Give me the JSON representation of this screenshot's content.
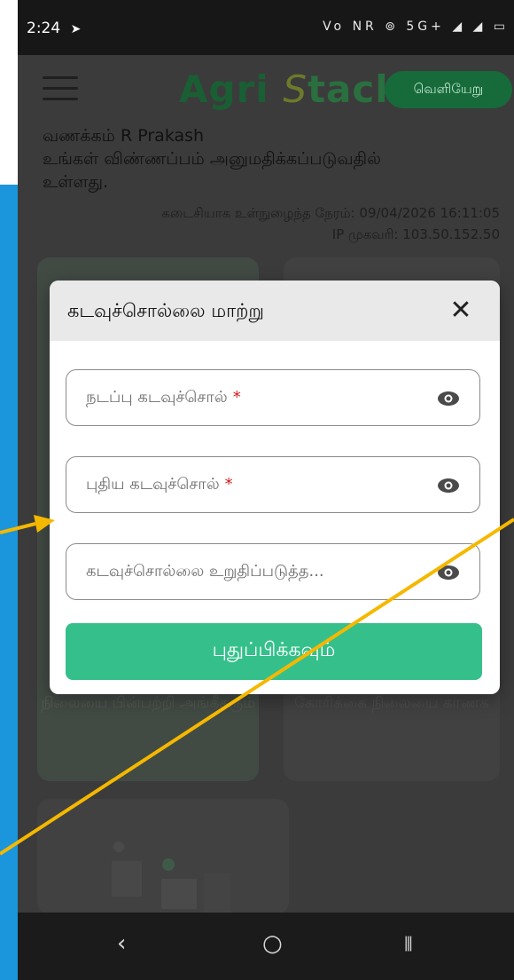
{
  "status_bar": {
    "time": "2:24",
    "nav_icon": "navigation-arrow-icon",
    "icons": "Vo NR ⊚ 5G+ ◢ ◢ ▭"
  },
  "header": {
    "brand_a": "Agri ",
    "brand_s": "S",
    "brand_rest": "tack",
    "logout_label": "வெளியேறு"
  },
  "greeting": {
    "hello": "வணக்கம் R Prakash",
    "line2": "உங்கள் விண்ணப்பம் அனுமதிக்கப்படுவதில்",
    "line3": "உள்ளது."
  },
  "last_login": {
    "label": "கடைசியாக உள்நுழைந்த நேரம்: 09/04/2026 16:11:05",
    "ip": "IP முகவரி: 103.50.152.50"
  },
  "cards": {
    "card1_caption": "நிலையை பின்பற்றி அங்கீகரும்",
    "card2_caption": "கோரிக்கை நிலையை காணக"
  },
  "modal": {
    "title": "கடவுச்சொல்லை மாற்று",
    "close_icon": "close-icon",
    "current_password_label": "நடப்பு கடவுச்சொல்",
    "new_password_label": "புதிய கடவுச்சொல்",
    "confirm_password_label": "கடவுச்சொல்லை உறுதிப்படுத்த...",
    "required_mark": "*",
    "submit_label": "புதுப்பிக்கவும்"
  },
  "nav": {
    "back": "‹",
    "home": "○",
    "recent": "⦀"
  },
  "colors": {
    "accent_green": "#35c08b",
    "logout_green": "#176a3a",
    "annotation_arrow": "#f5b800",
    "slide_blue": "#1b95db"
  }
}
